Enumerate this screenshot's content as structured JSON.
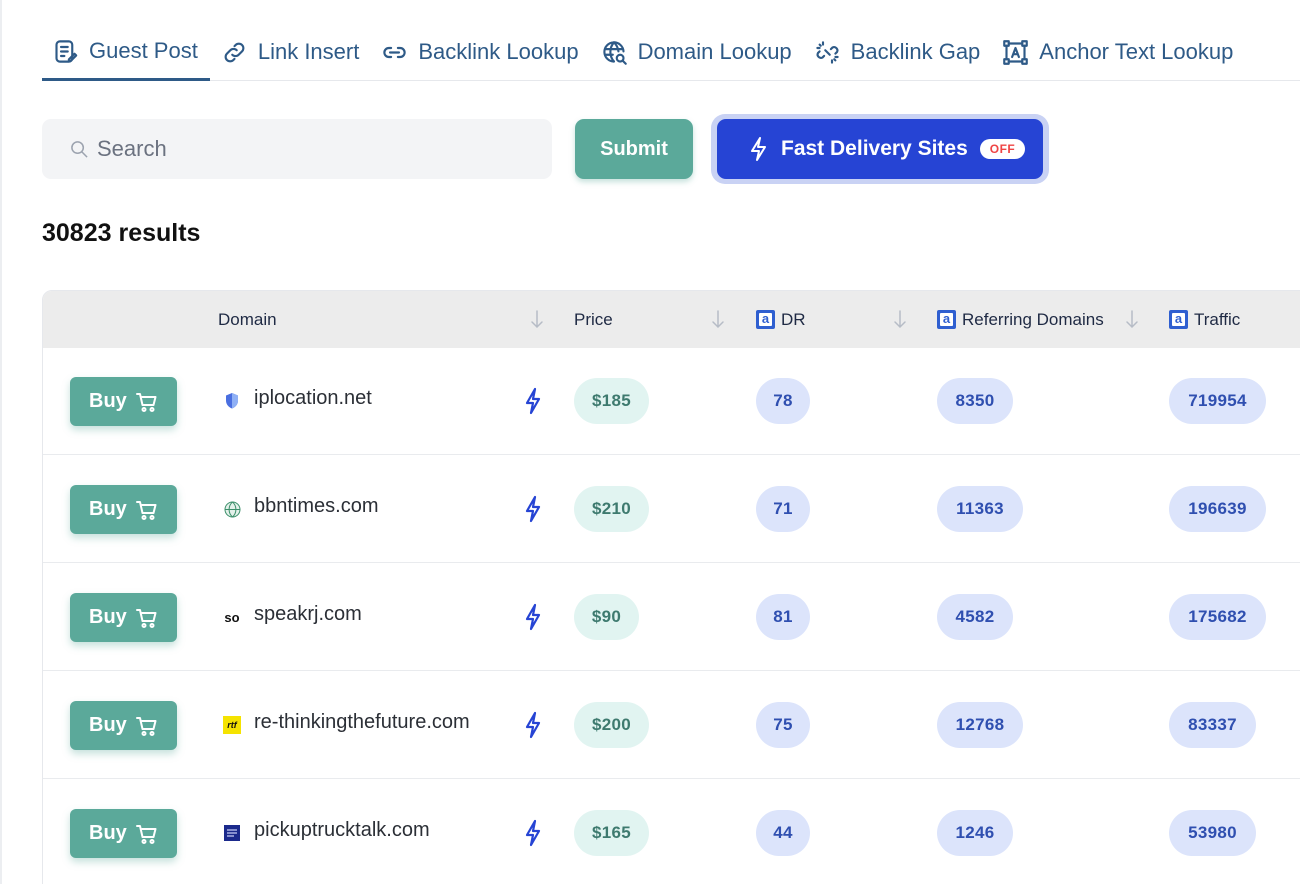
{
  "tabs": [
    {
      "label": "Guest Post",
      "icon": "guest-post-icon",
      "active": true
    },
    {
      "label": "Link Insert",
      "icon": "link-icon"
    },
    {
      "label": "Backlink Lookup",
      "icon": "chain-link-icon"
    },
    {
      "label": "Domain Lookup",
      "icon": "globe-search-icon"
    },
    {
      "label": "Backlink Gap",
      "icon": "broken-link-icon"
    },
    {
      "label": "Anchor Text Lookup",
      "icon": "anchor-text-icon"
    }
  ],
  "search": {
    "placeholder": "Search",
    "value": ""
  },
  "submit_label": "Submit",
  "fast_delivery": {
    "label": "Fast Delivery Sites",
    "status": "OFF"
  },
  "results_text": "30823 results",
  "table": {
    "columns": {
      "domain": "Domain",
      "price": "Price",
      "dr": "DR",
      "referring_domains": "Referring Domains",
      "traffic": "Traffic"
    },
    "buy_label": "Buy",
    "rows": [
      {
        "domain": "iplocation.net",
        "favicon": "shield-favicon",
        "price": "$185",
        "dr": "78",
        "referring_domains": "8350",
        "traffic": "719954"
      },
      {
        "domain": "bbntimes.com",
        "favicon": "globe-favicon",
        "price": "$210",
        "dr": "71",
        "referring_domains": "11363",
        "traffic": "196639"
      },
      {
        "domain": "speakrj.com",
        "favicon": "so",
        "price": "$90",
        "dr": "81",
        "referring_domains": "4582",
        "traffic": "175682"
      },
      {
        "domain": "re-thinkingthefuture.com",
        "favicon": "rtf",
        "price": "$200",
        "dr": "75",
        "referring_domains": "12768",
        "traffic": "83337"
      },
      {
        "domain": "pickuptrucktalk.com",
        "favicon": "ptt-favicon",
        "price": "$165",
        "dr": "44",
        "referring_domains": "1246",
        "traffic": "53980"
      }
    ]
  },
  "colors": {
    "accent_green": "#5ba99a",
    "accent_blue": "#2644d4",
    "tab_blue": "#2e5a87",
    "off_red": "#ef4444"
  }
}
